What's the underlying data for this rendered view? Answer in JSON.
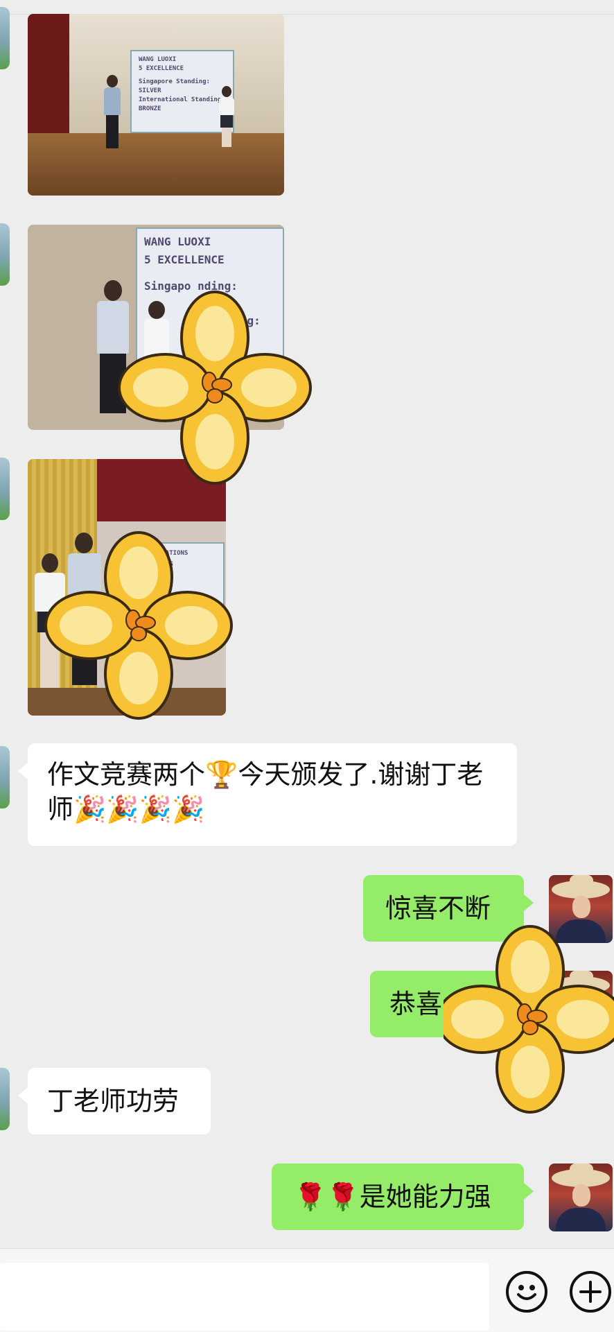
{
  "photos": [
    {
      "slide_lines": [
        "WANG LUOXI",
        "5 EXCELLENCE",
        "Singapore Standing:",
        "SILVER",
        "International Standing:",
        "BRONZE"
      ]
    },
    {
      "slide_lines": [
        "WANG LUOXI",
        "5 EXCELLENCE",
        "Singapo   nding:",
        "nding:"
      ]
    },
    {
      "slide_lines": [
        "ULATIONS",
        "RONG"
      ]
    }
  ],
  "messages": [
    {
      "side": "left",
      "text": "作文竞赛两个🏆今天颁发了.谢谢丁老师🎉🎉🎉🎉"
    },
    {
      "side": "right",
      "text": "惊喜不断"
    },
    {
      "side": "right",
      "text": "恭喜"
    },
    {
      "side": "left",
      "text": "丁老师功劳"
    },
    {
      "side": "right",
      "text": "🌹🌹是她能力强"
    }
  ],
  "icons": {
    "emoji_button": "smiley-icon",
    "more_button": "plus-icon",
    "sticker": "yellow-flower-sticker"
  },
  "colors": {
    "background": "#ededed",
    "bubble_self": "#95ec69",
    "bubble_other": "#ffffff"
  }
}
